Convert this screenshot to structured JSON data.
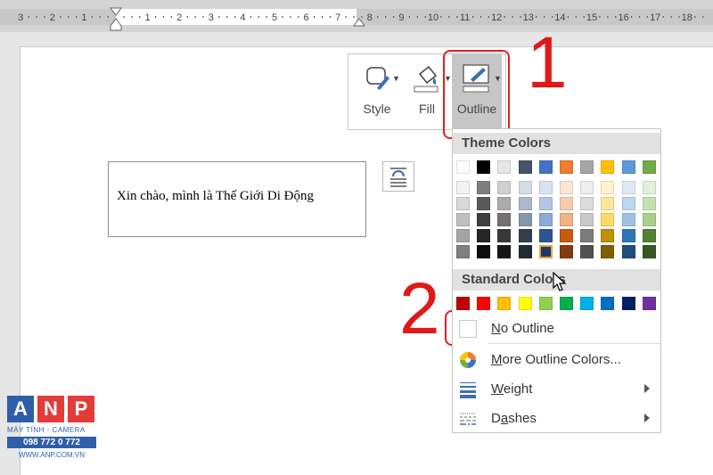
{
  "ruler": {
    "left_numbers": [
      "3",
      "2",
      "1"
    ],
    "right_numbers": [
      "1",
      "2",
      "3",
      "4",
      "5",
      "6",
      "7",
      "8",
      "9",
      "10",
      "11",
      "12",
      "13",
      "14",
      "15",
      "16",
      "17",
      "18"
    ]
  },
  "document": {
    "textbox_text": "Xin chào, mình là Thế Giới Di Động"
  },
  "ribbon": {
    "style_label": "Style",
    "fill_label": "Fill",
    "outline_label": "Outline"
  },
  "annotations": {
    "step1": "1",
    "step2": "2",
    "color": "#e02020"
  },
  "menu": {
    "theme_colors_label": "Theme Colors",
    "standard_colors_label": "Standard Colors",
    "theme_top_row": [
      "#ffffff",
      "#000000",
      "#e7e6e6",
      "#44546a",
      "#4472c4",
      "#ed7d31",
      "#a5a5a5",
      "#ffc000",
      "#5b9bd5",
      "#70ad47"
    ],
    "theme_shades": [
      [
        "#f2f2f2",
        "#7f7f7f",
        "#d0cece",
        "#d6dce4",
        "#d9e2f3",
        "#fbe5d5",
        "#ededed",
        "#fff2cc",
        "#deebf6",
        "#e2efd9"
      ],
      [
        "#d8d8d8",
        "#595959",
        "#aeabab",
        "#adb9ca",
        "#b4c6e7",
        "#f7cbac",
        "#dbdbdb",
        "#fee599",
        "#bdd7ee",
        "#c5e0b3"
      ],
      [
        "#bfbfbf",
        "#3f3f3f",
        "#757070",
        "#8496b0",
        "#8eaadb",
        "#f4b183",
        "#c9c9c9",
        "#ffd965",
        "#9cc3e5",
        "#a8d08d"
      ],
      [
        "#a5a5a5",
        "#262626",
        "#3a3838",
        "#323f4f",
        "#2f5496",
        "#c55a11",
        "#7b7b7b",
        "#bf9000",
        "#2e75b5",
        "#538135"
      ],
      [
        "#7f7f7f",
        "#0c0c0c",
        "#171616",
        "#222a35",
        "#1f3864",
        "#833c0b",
        "#525252",
        "#7f6000",
        "#1e4e79",
        "#375623"
      ]
    ],
    "standard_colors": [
      "#c00000",
      "#ff0000",
      "#ffc000",
      "#ffff00",
      "#92d050",
      "#00b050",
      "#00b0f0",
      "#0070c0",
      "#002060",
      "#7030a0"
    ],
    "no_outline_label": "No Outline",
    "more_colors_label": "More Outline Colors...",
    "weight_label": "Weight",
    "dashes_label": "Dashes"
  },
  "logo": {
    "letters": [
      "A",
      "N",
      "P"
    ],
    "colors": [
      "#2f5ea8",
      "#e43b3b",
      "#e43b3b"
    ],
    "tagline": "MÁY TÍNH - CAMERA",
    "phone": "098 772 0 772",
    "website": "WWW.ANP.COM.VN"
  }
}
